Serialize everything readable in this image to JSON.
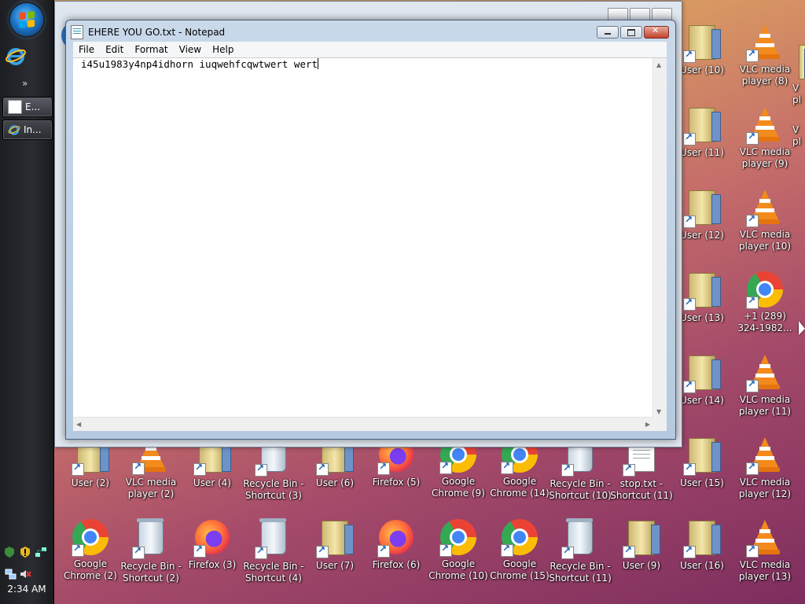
{
  "taskbar": {
    "buttons": [
      {
        "label": "E..."
      },
      {
        "label": "In..."
      }
    ],
    "quicklaunch_more": "»",
    "clock": "2:34 AM"
  },
  "notepad": {
    "title": "EHERE YOU GO.txt - Notepad",
    "menu": [
      "File",
      "Edit",
      "Format",
      "View",
      "Help"
    ],
    "content": "i45u1983y4np4idhorn iuqwehfcqwtwert wert"
  },
  "desktop_icons": [
    {
      "label": "User (10)",
      "kind": "folder"
    },
    {
      "label": "VLC media player (8)",
      "kind": "vlc"
    },
    {
      "label": "User (11)",
      "kind": "folder"
    },
    {
      "label": "VLC media player (9)",
      "kind": "vlc"
    },
    {
      "label": "User (12)",
      "kind": "folder"
    },
    {
      "label": "VLC media player (10)",
      "kind": "vlc"
    },
    {
      "label": "User (13)",
      "kind": "folder"
    },
    {
      "label": "+1 (289) 324-1982...",
      "kind": "chrome"
    },
    {
      "label": "User (14)",
      "kind": "folder"
    },
    {
      "label": "VLC media player (11)",
      "kind": "vlc"
    },
    {
      "label": "User (15)",
      "kind": "folder"
    },
    {
      "label": "VLC media player (12)",
      "kind": "vlc"
    },
    {
      "label": "User (2)",
      "kind": "folder"
    },
    {
      "label": "VLC media player (2)",
      "kind": "vlc"
    },
    {
      "label": "User (4)",
      "kind": "folder"
    },
    {
      "label": "Recycle Bin - Shortcut (3)",
      "kind": "bin"
    },
    {
      "label": "User (6)",
      "kind": "folder"
    },
    {
      "label": "Firefox (5)",
      "kind": "firefox"
    },
    {
      "label": "Google Chrome (9)",
      "kind": "chrome"
    },
    {
      "label": "Google Chrome (14)",
      "kind": "chrome"
    },
    {
      "label": "Recycle Bin - Shortcut (10)",
      "kind": "bin"
    },
    {
      "label": "stop.txt - Shortcut (11)",
      "kind": "txt"
    },
    {
      "label": "Google Chrome (2)",
      "kind": "chrome"
    },
    {
      "label": "Recycle Bin - Shortcut (2)",
      "kind": "bin"
    },
    {
      "label": "Firefox (3)",
      "kind": "firefox"
    },
    {
      "label": "Recycle Bin - Shortcut (4)",
      "kind": "bin"
    },
    {
      "label": "User (7)",
      "kind": "folder"
    },
    {
      "label": "Firefox (6)",
      "kind": "firefox"
    },
    {
      "label": "Google Chrome (10)",
      "kind": "chrome"
    },
    {
      "label": "Google Chrome (15)",
      "kind": "chrome"
    },
    {
      "label": "Recycle Bin - Shortcut (11)",
      "kind": "bin"
    },
    {
      "label": "User (9)",
      "kind": "folder"
    },
    {
      "label": "User (16)",
      "kind": "folder"
    },
    {
      "label": "VLC media player (13)",
      "kind": "vlc"
    }
  ],
  "partial_right_labels": [
    "V",
    "pl",
    "V",
    "pl"
  ]
}
